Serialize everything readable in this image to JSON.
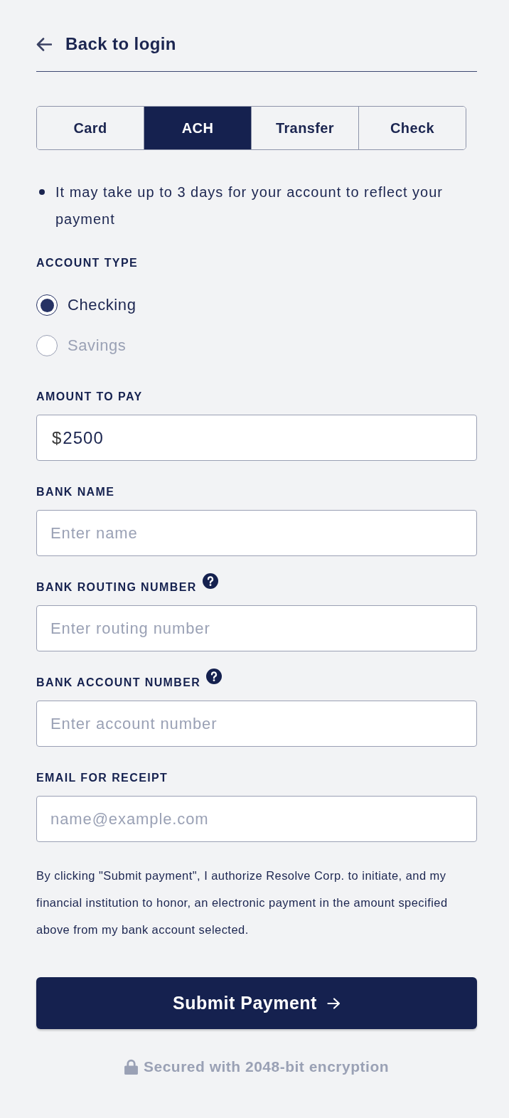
{
  "back_link": {
    "label": "Back to login"
  },
  "tabs": [
    {
      "label": "Card",
      "selected": false
    },
    {
      "label": "ACH",
      "selected": true
    },
    {
      "label": "Transfer",
      "selected": false
    },
    {
      "label": "Check",
      "selected": false
    }
  ],
  "notes": [
    "It may take up to 3 days for your account to reflect your payment"
  ],
  "account_type": {
    "label": "ACCOUNT TYPE",
    "options": [
      {
        "label": "Checking",
        "selected": true
      },
      {
        "label": "Savings",
        "selected": false
      }
    ]
  },
  "fields": [
    {
      "kind": "amount",
      "label": "AMOUNT TO PAY",
      "prefix": "$",
      "value": "2500",
      "help": false
    },
    {
      "kind": "text",
      "label": "BANK NAME",
      "placeholder": "Enter name",
      "help": false
    },
    {
      "kind": "text",
      "label": "BANK ROUTING NUMBER",
      "placeholder": "Enter routing number",
      "help": true
    },
    {
      "kind": "text",
      "label": "BANK ACCOUNT NUMBER",
      "placeholder": "Enter account number",
      "help": true
    },
    {
      "kind": "text",
      "label": "EMAIL FOR RECEIPT",
      "placeholder": "name@example.com",
      "help": false
    }
  ],
  "consent": "By clicking \"Submit payment\", I authorize Resolve Corp. to initiate, and my financial institution to honor, an electronic payment in the amount specified above from my bank account selected.",
  "submit_button": {
    "label": "Submit Payment"
  },
  "security_note": "Secured with 2048-bit encryption"
}
